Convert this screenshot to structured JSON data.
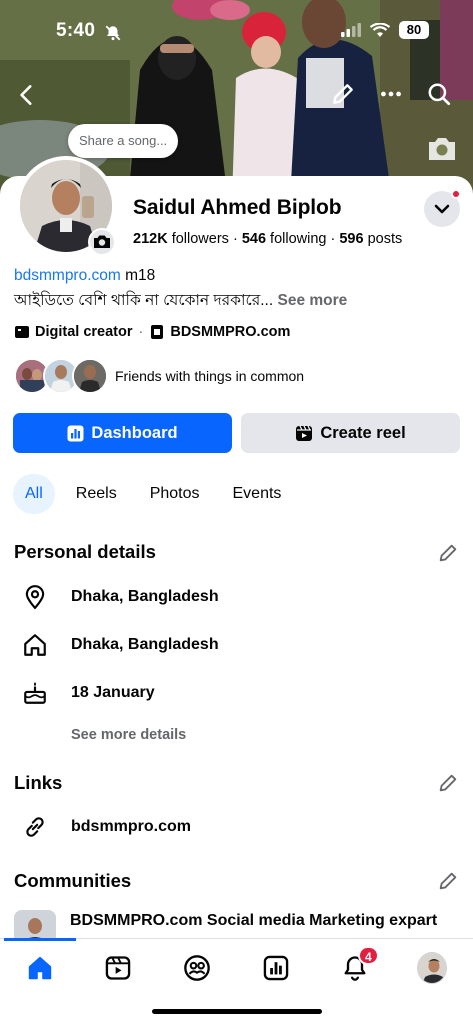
{
  "status_bar": {
    "time": "5:40",
    "battery": "80"
  },
  "cover": {
    "share_song_placeholder": "Share a song..."
  },
  "profile": {
    "name": "Saidul Ahmed Biplob",
    "followers_count": "212K",
    "followers_label": " followers",
    "following_count": "546",
    "following_label": " following",
    "posts_count": "596",
    "posts_label": " posts",
    "separator": " · ",
    "bio_link": "bdsmmpro.com",
    "bio_suffix": " m18",
    "bio_text": "আইডিতে বেশি থাকি না যেকোন দরকারে...",
    "see_more": " See more",
    "category": "Digital creator",
    "page_name": "BDSMMPRO.com",
    "friends_common": "Friends with things in common"
  },
  "actions": {
    "dashboard": "Dashboard",
    "create_reel": "Create reel"
  },
  "tabs": [
    {
      "label": "All",
      "active": true
    },
    {
      "label": "Reels",
      "active": false
    },
    {
      "label": "Photos",
      "active": false
    },
    {
      "label": "Events",
      "active": false
    }
  ],
  "personal_details": {
    "title": "Personal details",
    "location": "Dhaka, Bangladesh",
    "hometown": "Dhaka, Bangladesh",
    "birthday": "18 January",
    "see_more": "See more details"
  },
  "links": {
    "title": "Links",
    "url": "bdsmmpro.com"
  },
  "communities": {
    "title": "Communities",
    "item_name": "BDSMMPRO.com Social media Marketing expart"
  },
  "bottom_nav": {
    "items": [
      "home-icon",
      "video-icon",
      "friends-icon",
      "dashboard-icon",
      "notifications-icon",
      "profile-avatar"
    ],
    "notifications_badge": "4"
  },
  "colors": {
    "accent": "#0866ff",
    "secondary_button": "#e4e6eb",
    "badge": "#e41e3f",
    "muted_text": "#65676b"
  }
}
